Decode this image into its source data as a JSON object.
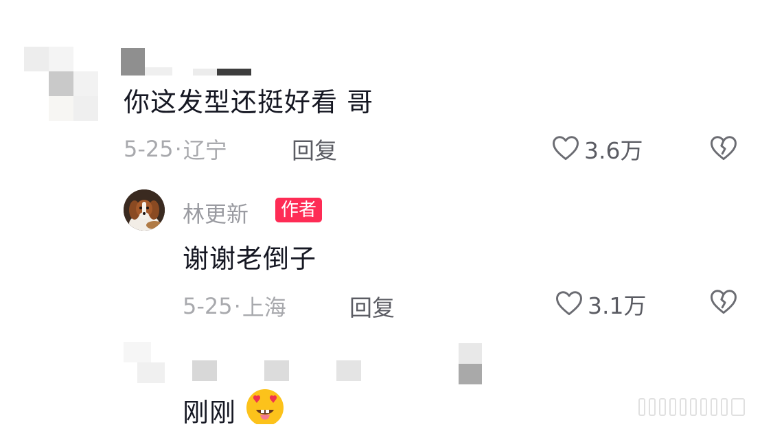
{
  "comment1": {
    "text": "你这发型还挺好看 哥",
    "date": "5-25",
    "separator": "·",
    "location": "辽宁",
    "reply_label": "回复",
    "like_count": "3.6万"
  },
  "reply1": {
    "username": "林更新",
    "badge": "作者",
    "text": "谢谢老倒子",
    "date": "5-25",
    "separator": "·",
    "location": "上海",
    "reply_label": "回复",
    "like_count": "3.1万"
  },
  "reply2": {
    "text": "刚刚"
  },
  "icons": {
    "like": "heart-outline-icon",
    "dislike": "broken-heart-icon",
    "emoji": "heart-eyes-tongue-emoji"
  },
  "colors": {
    "badge": "#fe2c55",
    "meta": "#a8a9ad",
    "action": "#5b5c63"
  }
}
